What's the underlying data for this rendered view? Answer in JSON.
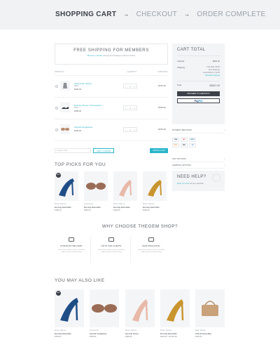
{
  "steps": {
    "cart": "SHOPPING CART",
    "checkout": "CHECKOUT",
    "complete": "ORDER COMPLETE",
    "arrow": "→"
  },
  "banner": {
    "title": "FREE SHIPPING FOR MEMBERS",
    "text_pre": "",
    "link": "Become a member",
    "text_post": " and get free shipping on all your orders!"
  },
  "table": {
    "product": "PRODUCT",
    "quantity": "QUANTITY",
    "subtotal": "SUBTOTAL"
  },
  "items": [
    {
      "name": "Superclean Jacket",
      "sub": "Black",
      "price": "$150.00",
      "qty": "1",
      "subtotal": "$150.00"
    },
    {
      "name": "Evening Shoes / Dovengolem",
      "sub": "Black",
      "price": "$188.00",
      "qty": "1",
      "subtotal": "$188.00"
    },
    {
      "name": "Special Sunglasses",
      "sub": "",
      "price": "$199.00",
      "qty": "1",
      "subtotal": "$199.00"
    }
  ],
  "coupon": {
    "placeholder": "Coupon code",
    "apply": "APPLY COUPON",
    "update": "UPDATE CART"
  },
  "summary": {
    "title": "CART TOTAL",
    "subtotal_label": "Subtotal",
    "subtotal": "$800.00",
    "shipping_label": "Shipping",
    "ship1": "Flat Rate: $5.00",
    "ship2": "Free Shipping",
    "ship3": "Local Delivery: $2.00",
    "change": "Calculate shipping",
    "total_label": "Total",
    "total": "$832.00",
    "checkout": "PROCEED TO CHECKOUT",
    "paypal_a": "Pay",
    "paypal_b": "Pal"
  },
  "payment": {
    "label": "PAYMENT METHODS",
    "cards": [
      "VISA",
      "MC",
      "AMEX",
      "DISC",
      "PAY",
      "CB"
    ]
  },
  "accordions": [
    {
      "label": "GIFT OPTIONS"
    },
    {
      "label": "SHIPPING OPTIONS"
    }
  ],
  "help": {
    "title": "NEED HELP?",
    "pre": "",
    "link": "Drop us a line",
    "post": " for any question"
  },
  "top_picks": {
    "title": "TOP PICKS FOR YOU",
    "items": [
      {
        "cat": "Shoes, Women",
        "name": "Evening Essentials",
        "price": "$168.00",
        "badge": "SALE"
      },
      {
        "cat": "Accessories",
        "name": "Evening Essentials",
        "price": "$168.00"
      },
      {
        "cat": "Shoes, Women",
        "name": "Evening Essentials",
        "price": "$168.00"
      },
      {
        "cat": "Shoes, Women",
        "name": "Evening Essentials",
        "price": "$168.00"
      }
    ]
  },
  "why": {
    "title": "WHY CHOOSE THEGEM SHOP?",
    "features": [
      {
        "title": "ULTRAFAST DELIVERY",
        "desc": "Lorem ipsum dolor sit amet consectetur adipiscing elit sed do eiusmod"
      },
      {
        "title": "GIFTS FOR CLIENTS",
        "desc": "Lorem ipsum dolor sit amet consectetur adipiscing elit sed do eiusmod"
      },
      {
        "title": "SAFE PACKAGING",
        "desc": "Lorem ipsum dolor sit amet consectetur adipiscing elit sed do eiusmod"
      }
    ]
  },
  "also_like": {
    "title": "YOU MAY ALSO LIKE",
    "items": [
      {
        "cat": "Shoes, Women",
        "name": "Evening Essentials",
        "price": "$168.00",
        "badge": "SALE"
      },
      {
        "cat": "Accessories",
        "name": "Special Sunglasses",
        "price": "$199.00"
      },
      {
        "cat": "Shoes, Women",
        "name": "Evening Shoes",
        "price": "$188.00"
      },
      {
        "cat": "Shoes, Women",
        "name": "Evening Essentials",
        "price": "$120.00 – $1,200.00"
      },
      {
        "cat": "Bags, Women",
        "name": "Little Evening Bag",
        "price": "$135.00"
      }
    ]
  }
}
